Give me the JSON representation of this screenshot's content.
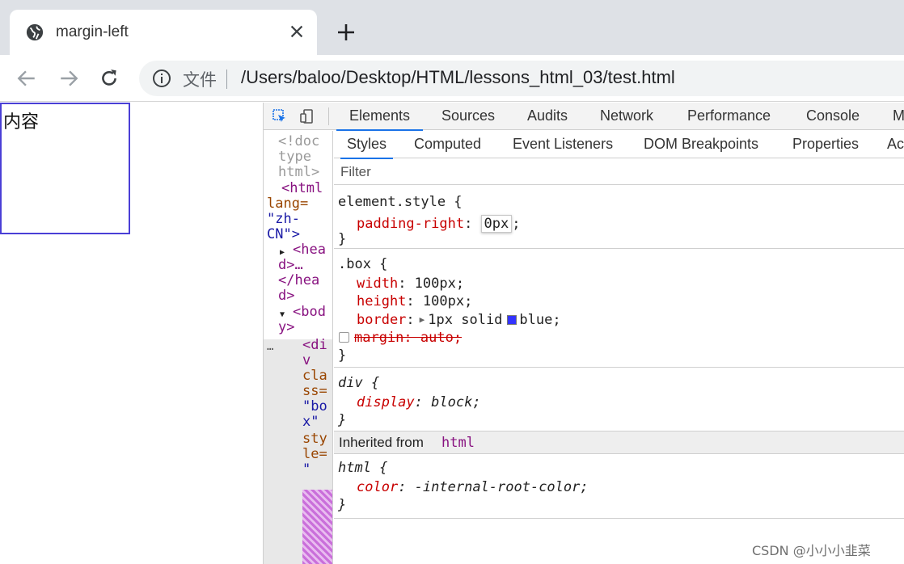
{
  "browser": {
    "tab": {
      "title": "margin-left",
      "favicon": "globe-icon"
    },
    "omnibox": {
      "file_label": "文件",
      "url": "/Users/baloo/Desktop/HTML/lessons_html_03/test.html"
    }
  },
  "page": {
    "box_text": "内容",
    "box_border_color": "#4a3fd6"
  },
  "devtools": {
    "tabs": [
      "Elements",
      "Sources",
      "Audits",
      "Network",
      "Performance",
      "Console",
      "M"
    ],
    "active_tab": "Elements",
    "sub_tabs": [
      "Styles",
      "Computed",
      "Event Listeners",
      "DOM Breakpoints",
      "Properties",
      "Ac"
    ],
    "active_sub_tab": "Styles",
    "filter_placeholder": "Filter",
    "dom_tree": {
      "doctype": [
        "<!doc",
        "type",
        "html>"
      ],
      "html_tag": [
        "<html",
        "lang=",
        "\"zh-",
        "CN\">"
      ],
      "head": [
        "<hea",
        "d>…",
        "</hea",
        "d>"
      ],
      "body": [
        "<bod",
        "y>"
      ],
      "ellipsis": "…",
      "div": [
        "<di",
        "v",
        "cla",
        "ss=",
        "\"bo",
        "x\"",
        "sty",
        "le=",
        "\""
      ]
    },
    "styles": {
      "element_style": {
        "selector": "element.style {",
        "prop": "padding-right",
        "value": "0px",
        "close": "}"
      },
      "box_rule": {
        "selector": ".box {",
        "width_prop": "width",
        "width_val": "100px;",
        "height_prop": "height",
        "height_val": "100px;",
        "border_prop": "border",
        "border_val": "1px solid",
        "border_color_name": "blue;",
        "border_color": "#3333ff",
        "margin_decl": "margin: auto;",
        "close": "}"
      },
      "div_rule": {
        "selector": "div {",
        "prop": "display",
        "value": "block;",
        "close": "}"
      },
      "inherited": {
        "label": "Inherited from",
        "tag": "html"
      },
      "html_rule": {
        "selector": "html {",
        "prop": "color",
        "value": "-internal-root-color;",
        "close": "}"
      }
    }
  },
  "watermark": "CSDN @小小小韭菜"
}
